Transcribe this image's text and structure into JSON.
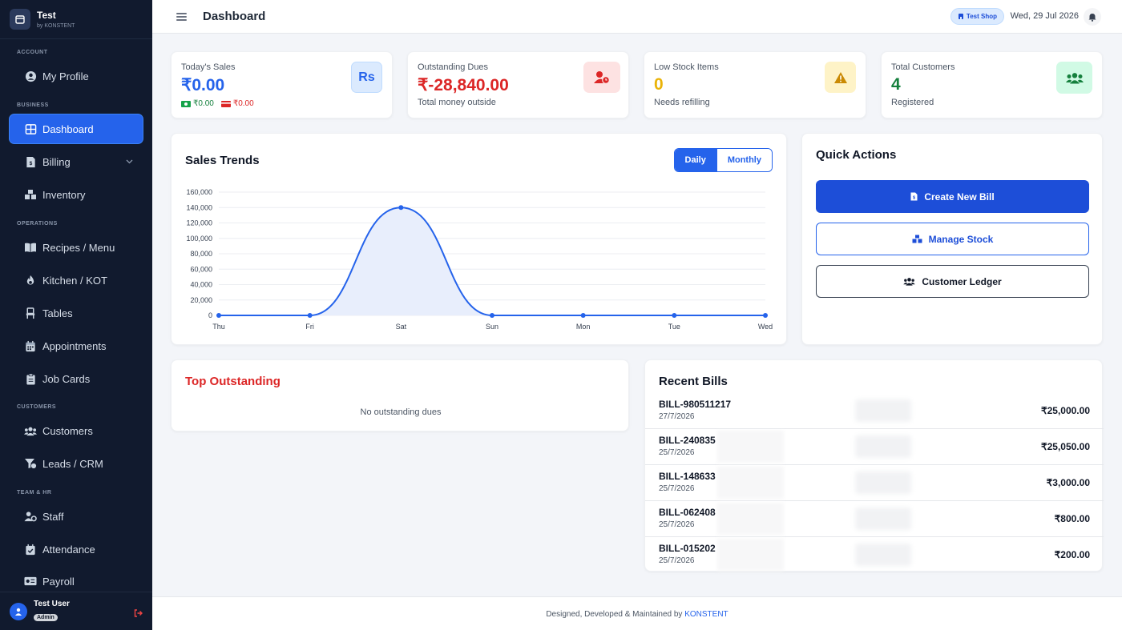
{
  "brand": {
    "name": "Test",
    "sub": "by KONSTENT"
  },
  "sidebar": {
    "sections": [
      {
        "label": "ACCOUNT"
      },
      {
        "label": "BUSINESS"
      },
      {
        "label": "OPERATIONS"
      },
      {
        "label": "CUSTOMERS"
      },
      {
        "label": "TEAM & HR"
      }
    ],
    "items": [
      {
        "label": "My Profile",
        "icon": "user-circle-icon"
      },
      {
        "label": "Dashboard",
        "icon": "grid-icon",
        "active": true
      },
      {
        "label": "Billing",
        "icon": "invoice-icon",
        "has_submenu": true
      },
      {
        "label": "Inventory",
        "icon": "boxes-icon"
      },
      {
        "label": "Recipes / Menu",
        "icon": "book-icon"
      },
      {
        "label": "Kitchen / KOT",
        "icon": "fire-icon"
      },
      {
        "label": "Tables",
        "icon": "chair-icon"
      },
      {
        "label": "Appointments",
        "icon": "calendar-icon"
      },
      {
        "label": "Job Cards",
        "icon": "clipboard-icon"
      },
      {
        "label": "Customers",
        "icon": "users-icon"
      },
      {
        "label": "Leads / CRM",
        "icon": "funnel-icon"
      },
      {
        "label": "Staff",
        "icon": "user-gear-icon"
      },
      {
        "label": "Attendance",
        "icon": "calendar-check-icon"
      },
      {
        "label": "Payroll",
        "icon": "money-card-icon"
      }
    ],
    "user": {
      "name": "Test User",
      "role": "Admin"
    }
  },
  "topbar": {
    "title": "Dashboard",
    "shop": "Test Shop",
    "date": "Wed, 29 Jul 2026"
  },
  "stats": {
    "sales": {
      "label": "Today's Sales",
      "value": "₹0.00",
      "cash": "₹0.00",
      "card": "₹0.00",
      "icon": "Rs"
    },
    "dues": {
      "label": "Outstanding Dues",
      "value": "₹-28,840.00",
      "sub": "Total money outside"
    },
    "stock": {
      "label": "Low Stock Items",
      "value": "0",
      "sub": "Needs refilling"
    },
    "customers": {
      "label": "Total Customers",
      "value": "4",
      "sub": "Registered"
    }
  },
  "trends": {
    "title": "Sales Trends",
    "daily": "Daily",
    "monthly": "Monthly"
  },
  "chart_data": {
    "type": "area",
    "categories": [
      "Thu",
      "Fri",
      "Sat",
      "Sun",
      "Mon",
      "Tue",
      "Wed"
    ],
    "values": [
      0,
      0,
      140000,
      0,
      0,
      0,
      0
    ],
    "ylim": [
      0,
      160000
    ],
    "yticks": [
      "0",
      "20,000",
      "40,000",
      "60,000",
      "80,000",
      "100,000",
      "120,000",
      "140,000",
      "160,000"
    ],
    "color": "#2563eb",
    "fill": "#e8eefc",
    "title": "",
    "xlabel": "",
    "ylabel": "",
    "grid": true
  },
  "quick": {
    "title": "Quick Actions",
    "create": "Create New Bill",
    "stock": "Manage Stock",
    "ledger": "Customer Ledger"
  },
  "outstanding": {
    "title": "Top Outstanding",
    "empty": "No outstanding dues"
  },
  "recent": {
    "title": "Recent Bills",
    "bills": [
      {
        "id": "BILL-980511217",
        "date": "27/7/2026",
        "amount": "₹25,000.00"
      },
      {
        "id": "BILL-240835",
        "date": "25/7/2026",
        "amount": "₹25,050.00"
      },
      {
        "id": "BILL-148633",
        "date": "25/7/2026",
        "amount": "₹3,000.00"
      },
      {
        "id": "BILL-062408",
        "date": "25/7/2026",
        "amount": "₹800.00"
      },
      {
        "id": "BILL-015202",
        "date": "25/7/2026",
        "amount": "₹200.00"
      }
    ]
  },
  "footer": {
    "text": "Designed, Developed & Maintained by",
    "link": "KONSTENT"
  }
}
